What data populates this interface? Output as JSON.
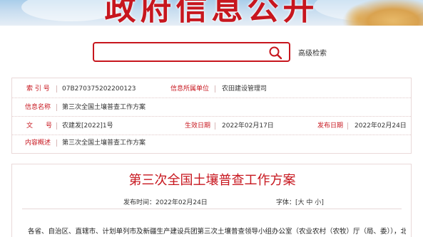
{
  "banner": {
    "title": "政府信息公开"
  },
  "search": {
    "placeholder": "",
    "value": "",
    "advanced_label": "高级检索"
  },
  "info": {
    "index_label": "索 引 号",
    "index_value": "07B270375202200123",
    "org_label": "信息所属单位",
    "org_value": "农田建设管理司",
    "name_label": "信息名称",
    "name_value": "第三次全国土壤普查工作方案",
    "doc_label": "文　　号",
    "doc_value": "农建发[2022]1号",
    "effective_label": "生效日期",
    "effective_value": "2022年02月17日",
    "release_label": "发布日期",
    "release_value": "2022年02月24日",
    "summary_label": "内容概述",
    "summary_value": "第三次全国土壤普查工作方案"
  },
  "article": {
    "title": "第三次全国土壤普查工作方案",
    "date_text": "发布时间：2022年02月24日",
    "font_label": "字体：[",
    "font_large": "大",
    "font_medium": "中",
    "font_small": "小",
    "font_close": "]",
    "body_first_line": "各省、自治区、直辖市、计划单列市及新疆生产建设兵团第三次土壤普查领导小组办公室（农业农村（农牧）厅（局、委）），北大"
  },
  "colors": {
    "accent": "#c7161e",
    "text": "#333333",
    "border": "#ead9d9"
  }
}
